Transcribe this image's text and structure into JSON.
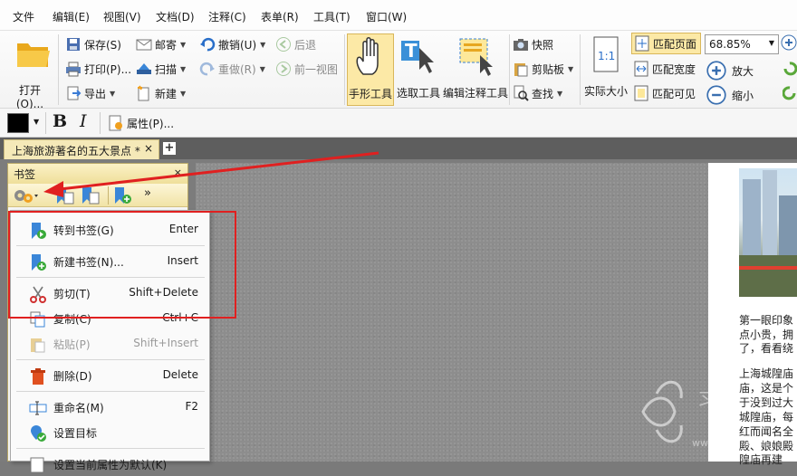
{
  "menu": [
    "文件",
    "编辑(E)",
    "视图(V)",
    "文档(D)",
    "注释(C)",
    "表单(R)",
    "工具(T)",
    "窗口(W)"
  ],
  "ribbon": {
    "open": "打开(O)...",
    "save": "保存(S)",
    "print": "打印(P)...",
    "export": "导出",
    "email": "邮寄",
    "scan": "扫描",
    "new": "新建",
    "undo": "撤销(U)",
    "redo": "重做(R)",
    "back": "后退",
    "prev_view": "前一视图",
    "hand_tool": "手形工具",
    "select_text": "选取工具",
    "edit_annot": "编辑注释工具",
    "snapshot": "快照",
    "clipboard": "剪贴板",
    "find": "查找",
    "actual_size": "实际大小",
    "fit_page": "匹配页面",
    "fit_width": "匹配宽度",
    "fit_visible": "匹配可见",
    "zoom_value": "68.85%",
    "zoom_in": "放大",
    "zoom_out": "缩小"
  },
  "format": {
    "bold": "B",
    "italic": "I",
    "properties": "属性(P)..."
  },
  "tab": {
    "title": "上海旅游著名的五大景点 *",
    "close": "×",
    "add": "+"
  },
  "bookmark_panel": {
    "title": "书签",
    "close": "×"
  },
  "context_menu": [
    {
      "label": "转到书签(G)",
      "shortcut": "Enter",
      "disabled": false
    },
    {
      "label": "新建书签(N)...",
      "shortcut": "Insert",
      "disabled": false
    },
    {
      "label": "剪切(T)",
      "shortcut": "Shift+Delete",
      "disabled": false
    },
    {
      "label": "复制(C)",
      "shortcut": "Ctrl+C",
      "disabled": false
    },
    {
      "label": "粘贴(P)",
      "shortcut": "Shift+Insert",
      "disabled": true
    },
    {
      "label": "删除(D)",
      "shortcut": "Delete",
      "disabled": false
    },
    {
      "label": "重命名(M)",
      "shortcut": "F2",
      "disabled": false
    },
    {
      "label": "设置目标",
      "shortcut": "",
      "disabled": false
    },
    {
      "label": "设置当前属性为默认(K)",
      "shortcut": "",
      "disabled": false
    }
  ],
  "document_text": [
    "第一眼印象",
    "点小贵，拥",
    "了，看看绕",
    "上海城隍庙",
    "庙，这是个",
    "于没到过大",
    "城隍庙，每",
    "红而闻名全",
    "殿、娘娘殿",
    "隍庙再建"
  ],
  "colors": {
    "annotation_red": "#e02020",
    "tab_active": "#f5e9b8",
    "highlight": "#fce9a6"
  },
  "icons": {
    "open": "folder-icon",
    "hand": "hand-icon",
    "select": "text-cursor-icon"
  }
}
